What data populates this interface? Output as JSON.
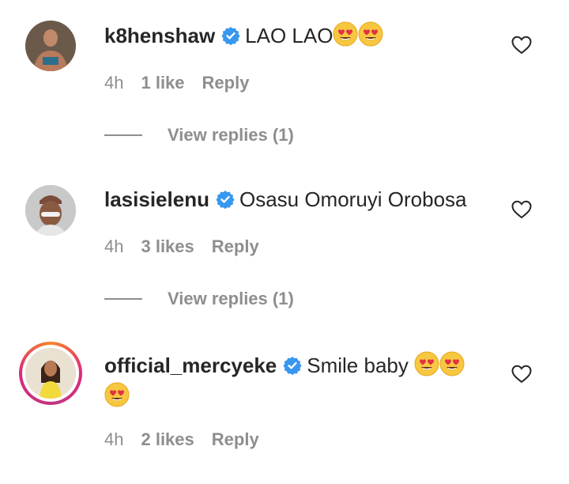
{
  "comments": [
    {
      "username": "k8henshaw",
      "text": "LAO LAO",
      "emoji": [
        "heart-eyes",
        "heart-eyes"
      ],
      "time": "4h",
      "likes": "1 like",
      "reply": "Reply",
      "view_replies": "View replies (1)"
    },
    {
      "username": "lasisielenu",
      "text": "Osasu Omoruyi Orobosa",
      "emoji": [],
      "time": "4h",
      "likes": "3 likes",
      "reply": "Reply",
      "view_replies": "View replies (1)"
    },
    {
      "username": "official_mercyeke",
      "text": "Smile baby ",
      "emoji": [
        "heart-eyes",
        "heart-eyes",
        "heart-eyes"
      ],
      "time": "4h",
      "likes": "2 likes",
      "reply": "Reply"
    }
  ],
  "colors": {
    "text": "#262626",
    "muted": "#8e8e8e",
    "verified": "#3897f0",
    "story_ring": [
      "#f58529",
      "#dd2a7b",
      "#c13584"
    ]
  }
}
